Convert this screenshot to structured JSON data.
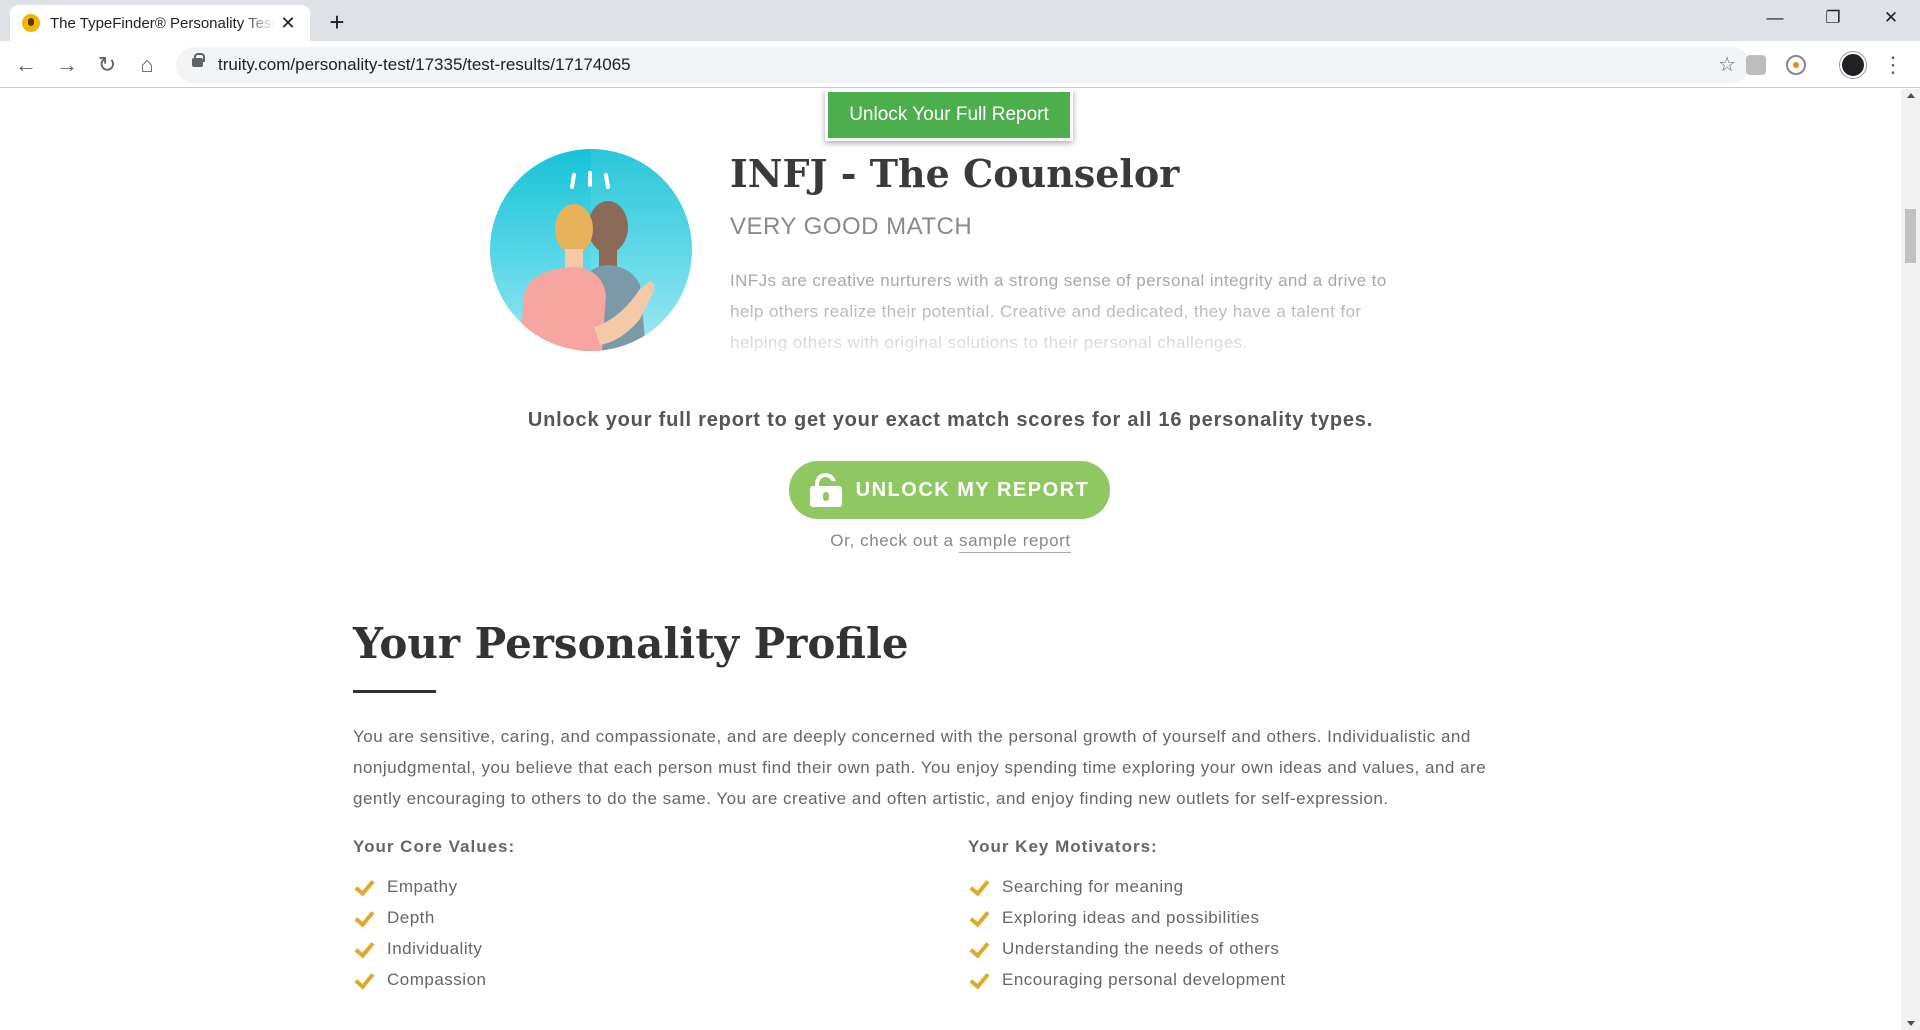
{
  "browser": {
    "tab_title": "The TypeFinder® Personality Test",
    "tab_close": "✕",
    "new_tab": "+",
    "url": "truity.com/personality-test/17335/test-results/17174065",
    "window": {
      "minimize": "—",
      "restore": "❐",
      "close": "✕"
    },
    "nav": {
      "back": "←",
      "forward": "→",
      "reload": "↻",
      "home": "⌂"
    },
    "bookmark_star": "☆",
    "menu": "⋮"
  },
  "page": {
    "banner_button": "Unlock Your Full Report",
    "type_title": "INFJ - The Counselor",
    "match_label": "VERY GOOD MATCH",
    "type_description": "INFJs are creative nurturers with a strong sense of personal integrity and a drive to help others realize their potential. Creative and dedicated, they have a talent for helping others with original solutions to their personal challenges.",
    "unlock_message": "Unlock your full report to get your exact match scores for all 16 personality types.",
    "unlock_button": "UNLOCK MY REPORT",
    "sample_prefix": "Or, check out a ",
    "sample_link": "sample report",
    "profile_heading": "Your Personality Profile",
    "profile_text": "You are sensitive, caring, and compassionate, and are deeply concerned with the personal growth of yourself and others. Individualistic and nonjudgmental, you believe that each person must find their own path. You enjoy spending time exploring your own ideas and values, and are gently encouraging to others to do the same. You are creative and often artistic, and enjoy finding new outlets for self-expression.",
    "core_values_title": "Your Core Values:",
    "core_values": [
      "Empathy",
      "Depth",
      "Individuality",
      "Compassion"
    ],
    "motivators_title": "Your Key Motivators:",
    "motivators": [
      "Searching for meaning",
      "Exploring ideas and possibilities",
      "Understanding the needs of others",
      "Encouraging personal development"
    ]
  },
  "colors": {
    "banner_green": "#4cae4c",
    "unlock_green": "#8fc860",
    "check_gold": "#e0a92a"
  }
}
